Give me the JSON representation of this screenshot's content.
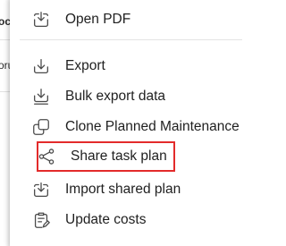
{
  "background": {
    "row_fragments": [
      "oc",
      "oru"
    ]
  },
  "menu": {
    "items": [
      {
        "label": "Open PDF",
        "icon": "open-pdf-icon"
      },
      {
        "label": "Export",
        "icon": "export-icon"
      },
      {
        "label": "Bulk export data",
        "icon": "bulk-export-icon"
      },
      {
        "label": "Clone Planned Maintenance",
        "icon": "clone-icon"
      },
      {
        "label": "Share task plan",
        "icon": "share-icon",
        "highlighted": true
      },
      {
        "label": "Import shared plan",
        "icon": "import-icon"
      },
      {
        "label": "Update costs",
        "icon": "update-costs-icon"
      }
    ],
    "highlight_color": "#e32b2b"
  }
}
